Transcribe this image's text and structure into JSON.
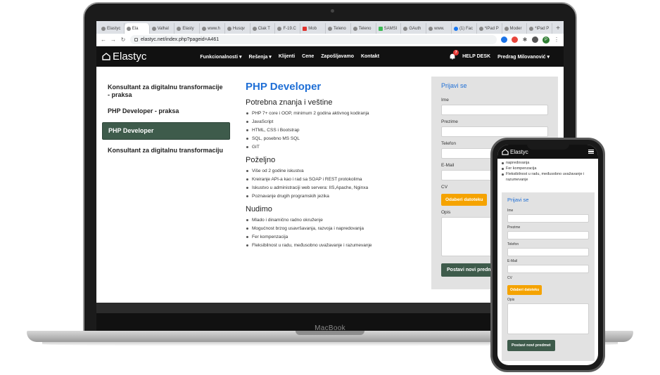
{
  "browser": {
    "tabs": [
      {
        "label": "Elastyc",
        "icon": "globe-icon",
        "active": false
      },
      {
        "label": "Ela",
        "icon": "globe-icon",
        "active": true
      },
      {
        "label": "Valhal",
        "icon": "globe-icon",
        "active": false
      },
      {
        "label": "Elasty",
        "icon": "globe-icon",
        "active": false
      },
      {
        "label": "www.h",
        "icon": "globe-icon",
        "active": false
      },
      {
        "label": "Husqv",
        "icon": "globe-icon",
        "active": false
      },
      {
        "label": "Clak T",
        "icon": "globe-icon",
        "active": false
      },
      {
        "label": "F-19.C",
        "icon": "globe-icon",
        "active": false
      },
      {
        "label": "Mob",
        "icon": "gmail-icon",
        "active": false
      },
      {
        "label": "Teleno",
        "icon": "globe-icon",
        "active": false
      },
      {
        "label": "Teleno",
        "icon": "globe-icon",
        "active": false
      },
      {
        "label": "SAMSI",
        "icon": "google-icon",
        "active": false
      },
      {
        "label": "GAuth",
        "icon": "globe-icon",
        "active": false
      },
      {
        "label": "www.",
        "icon": "globe-icon",
        "active": false
      },
      {
        "label": "(1) Fac",
        "icon": "facebook-icon",
        "active": false
      },
      {
        "label": "*iPad P",
        "icon": "globe-icon",
        "active": false
      },
      {
        "label": "Moder",
        "icon": "globe-icon",
        "active": false
      },
      {
        "label": "*iPad P",
        "icon": "globe-icon",
        "active": false
      }
    ],
    "new_tab": "+",
    "url": "elastyc.net/index.php?pageid=A461",
    "profile_initial": "P"
  },
  "site": {
    "logo": "Elastyc",
    "menu": [
      "Funkcionalnosti ▾",
      "Rešenja ▾",
      "Klijenti",
      "Cene",
      "Zapošljavamo",
      "Kontakt"
    ],
    "notification_count": "7",
    "help_desk": "HELP DESK",
    "user": "Predrag Milovanović ▾"
  },
  "sidebar": {
    "items": [
      {
        "label": "Konsultant za digitalnu transformacije - praksa",
        "active": false
      },
      {
        "label": "PHP Developer - praksa",
        "active": false
      },
      {
        "label": "PHP Developer",
        "active": true
      },
      {
        "label": "Konsultant za digitalnu transformaciju",
        "active": false
      }
    ]
  },
  "job": {
    "title": "PHP Developer",
    "sections": [
      {
        "heading": "Potrebna znanja i veštine",
        "items": [
          "PHP 7+ core i OOP, minimum 2 godina aktivnog kodiranja",
          "JavaScript",
          "HTML, CSS i Bootstrap",
          "SQL, posebno MS SQL",
          "GIT"
        ]
      },
      {
        "heading": "Poželjno",
        "items": [
          "Više od 2 godine iskustva",
          "Kreiranje API-a kao i rad sa SOAP i REST protokolima",
          "Iskustvo u administraciji web servera: IIS,Apache, Nginxa",
          "Poznavanje drugih programskih jezika"
        ]
      },
      {
        "heading": "Nudimo",
        "items": [
          "Mlado i dinamično radno okruženje",
          "Mogućnost brzog usavršavanja, razvoja i napredovanja",
          "Fer kompenzacija",
          "Fleksibilnost u radu, međusobno uvažavanje i razumevanje"
        ]
      }
    ]
  },
  "apply": {
    "title": "Prijavi se",
    "fields": [
      "Ime",
      "Prezime",
      "Telefon",
      "E-Mail"
    ],
    "cv_label": "CV",
    "file_button": "Odaberi datoteku",
    "desc_label": "Opis",
    "submit": "Postavi novi predmet"
  },
  "device": {
    "laptop_label": "MacBook"
  },
  "mobile": {
    "logo": "Elastyc",
    "items": [
      "napredovanja",
      "Fer kompenzacija",
      "Fleksibilnost u radu, međusobno uvažavanje i razumevanje"
    ]
  }
}
